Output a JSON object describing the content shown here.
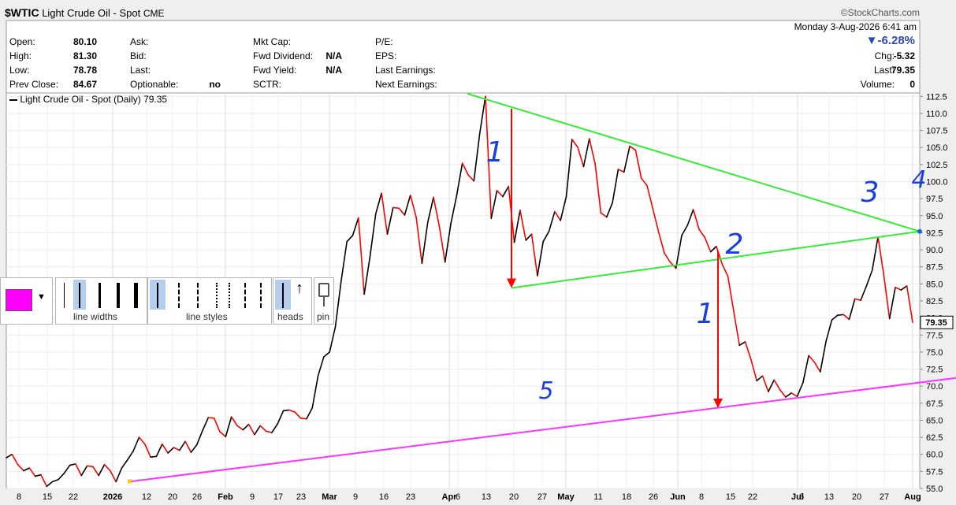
{
  "header": {
    "symbol": "$WTIC",
    "name": "Light Crude Oil - Spot",
    "exchange": "CME",
    "brand": "©StockCharts.com",
    "datetime": "Monday  3-Aug-2026  6:41 am",
    "change_pct": "▼-6.28%"
  },
  "quote": {
    "col1": [
      {
        "label": "Open:",
        "value": "80.10"
      },
      {
        "label": "High:",
        "value": "81.30"
      },
      {
        "label": "Low:",
        "value": "78.78"
      },
      {
        "label": "Prev Close:",
        "value": "84.67"
      }
    ],
    "col2": [
      {
        "label": "Ask:",
        "value": ""
      },
      {
        "label": "Bid:",
        "value": ""
      },
      {
        "label": "Last:",
        "value": ""
      },
      {
        "label": "Optionable:",
        "value": "no"
      }
    ],
    "col3": [
      {
        "label": "Mkt Cap:",
        "value": ""
      },
      {
        "label": "Fwd Dividend:",
        "value": "N/A"
      },
      {
        "label": "Fwd Yield:",
        "value": "N/A"
      },
      {
        "label": "SCTR:",
        "value": ""
      }
    ],
    "col4": [
      {
        "label": "P/E:"
      },
      {
        "label": "EPS:"
      },
      {
        "label": "Last Earnings:"
      },
      {
        "label": "Next Earnings:"
      }
    ],
    "right": [
      {
        "label": "Chg:",
        "value": "-5.32"
      },
      {
        "label": "Last:",
        "value": "79.35"
      },
      {
        "label": "Volume:",
        "value": "0"
      }
    ]
  },
  "legend": "Light Crude Oil - Spot (Daily) 79.35",
  "toolbar": {
    "line_widths": "line widths",
    "line_styles": "line styles",
    "heads": "heads",
    "pin": "pin",
    "color": "#ff00ff"
  },
  "annotations": [
    {
      "text": "1",
      "color": "#1a3fe0"
    },
    {
      "text": "2",
      "color": "#1a3fe0"
    },
    {
      "text": "1",
      "color": "#1a3fe0"
    },
    {
      "text": "3",
      "color": "#1a3fe0"
    },
    {
      "text": "4",
      "color": "#1a3fe0"
    },
    {
      "text": "5",
      "color": "#1a3fe0"
    }
  ],
  "chart_data": {
    "type": "line",
    "series_name": "Light Crude Oil - Spot (Daily)",
    "last_value": "79.35",
    "ylim": [
      55.0,
      113.0
    ],
    "y_ticks": [
      "55.0",
      "57.5",
      "60.0",
      "62.5",
      "65.0",
      "67.5",
      "70.0",
      "72.5",
      "75.0",
      "77.5",
      "80.0",
      "82.5",
      "85.0",
      "87.5",
      "90.0",
      "92.5",
      "95.0",
      "97.5",
      "100.0",
      "102.5",
      "105.0",
      "107.5",
      "110.0",
      "112.5"
    ],
    "x_ticks": [
      "8",
      "15",
      "22",
      "2026",
      "12",
      "20",
      "26",
      "Feb",
      "9",
      "17",
      "23",
      "Mar",
      "9",
      "16",
      "23",
      "Apr",
      "6",
      "13",
      "20",
      "27",
      "May",
      "11",
      "18",
      "26",
      "Jun",
      "8",
      "15",
      "22",
      "Jul",
      "6",
      "13",
      "20",
      "27",
      "Aug"
    ],
    "up_color": "#000000",
    "down_color": "#ff0000",
    "values": [
      59.5,
      60.0,
      58.5,
      57.6,
      58.0,
      56.8,
      57.0,
      55.3,
      56.0,
      56.3,
      57.2,
      58.4,
      58.6,
      56.9,
      58.3,
      58.2,
      56.9,
      58.5,
      57.6,
      56.0,
      58.0,
      59.2,
      60.5,
      62.5,
      61.5,
      59.6,
      59.7,
      61.5,
      60.2,
      61.0,
      60.6,
      61.9,
      60.3,
      61.4,
      63.5,
      65.4,
      65.3,
      63.3,
      62.6,
      65.5,
      64.2,
      63.6,
      64.4,
      62.9,
      64.2,
      63.4,
      63.2,
      64.5,
      66.4,
      66.5,
      66.2,
      65.3,
      65.2,
      66.8,
      71.5,
      74.3,
      75.0,
      78.7,
      85.4,
      91.2,
      92.1,
      94.7,
      83.5,
      89.0,
      95.3,
      98.3,
      92.3,
      96.2,
      96.1,
      95.1,
      98.0,
      94.8,
      88.0,
      94.0,
      97.7,
      93.5,
      88.2,
      93.8,
      97.9,
      102.7,
      101.0,
      100.1,
      107.0,
      112.5,
      94.6,
      98.7,
      97.8,
      99.3,
      91.1,
      95.8,
      91.4,
      92.3,
      86.2,
      91.2,
      92.7,
      95.6,
      94.3,
      97.8,
      106.2,
      105.0,
      102.2,
      106.3,
      102.6,
      95.4,
      94.8,
      96.9,
      101.8,
      101.4,
      105.2,
      104.6,
      100.5,
      99.4,
      96.0,
      92.6,
      89.5,
      88.2,
      87.3,
      92.1,
      93.6,
      95.9,
      93.0,
      91.8,
      89.7,
      90.5,
      87.9,
      86.1,
      81.0,
      76.0,
      76.5,
      73.9,
      70.8,
      71.5,
      69.2,
      70.9,
      69.5,
      68.4,
      69.0,
      68.5,
      70.5,
      74.5,
      73.5,
      72.1,
      76.6,
      79.7,
      80.4,
      80.5,
      79.8,
      82.8,
      82.6,
      84.7,
      87.0,
      91.9,
      86.3,
      79.9,
      84.5,
      84.1,
      84.7,
      79.35
    ],
    "annotation_lines": [
      {
        "name": "triangle-upper",
        "color": "#33ee33",
        "from": [
          "Apr 2",
          112.9
        ],
        "to": [
          "Aug 3",
          92.7
        ]
      },
      {
        "name": "triangle-lower",
        "color": "#33ee33",
        "from": [
          "Apr 20",
          84.4
        ],
        "to": [
          "Aug 3",
          92.7
        ]
      },
      {
        "name": "trendline",
        "color": "#ff33ff",
        "from": [
          "Jan 7",
          56.0
        ],
        "to": [
          "Aug 5",
          71.2
        ]
      },
      {
        "name": "measure-arrow-1",
        "color": "#ff0000",
        "from": [
          "Apr 20",
          110.7
        ],
        "to": [
          "Apr 20",
          84.4
        ]
      },
      {
        "name": "measure-arrow-2",
        "color": "#ff0000",
        "from": [
          "Jun 10",
          89.8
        ],
        "to": [
          "Jun 10",
          66.8
        ]
      }
    ]
  }
}
